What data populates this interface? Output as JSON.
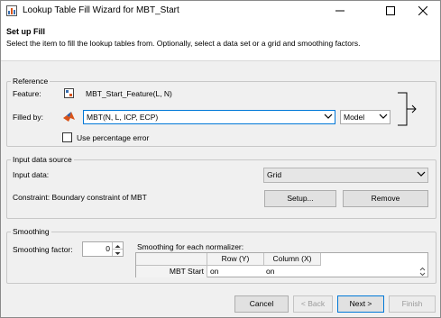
{
  "window": {
    "title": "Lookup Table Fill Wizard for MBT_Start"
  },
  "header": {
    "heading": "Set up Fill",
    "description": "Select the item to fill the lookup tables from. Optionally, select a data set or a grid and smoothing factors."
  },
  "reference": {
    "group_label": "Reference",
    "feature_label": "Feature:",
    "feature_value": "MBT_Start_Feature(L, N)",
    "filled_by_label": "Filled by:",
    "filled_by_value": "MBT(N, L, ICP, ECP)",
    "type_value": "Model",
    "percentage_error_label": "Use percentage error",
    "percentage_error_checked": false
  },
  "input_source": {
    "group_label": "Input data source",
    "input_data_label": "Input data:",
    "input_data_value": "Grid",
    "constraint_text": "Constraint: Boundary constraint of MBT",
    "setup_label": "Setup...",
    "remove_label": "Remove"
  },
  "smoothing": {
    "group_label": "Smoothing",
    "factor_label": "Smoothing factor:",
    "factor_value": "0",
    "per_normalizer_label": "Smoothing for each normalizer:",
    "columns": [
      "Row (Y)",
      "Column (X)"
    ],
    "rows": [
      {
        "name": "MBT Start",
        "values": [
          "on",
          "on"
        ]
      }
    ]
  },
  "footer": {
    "cancel_label": "Cancel",
    "back_label": "< Back",
    "next_label": "Next >",
    "finish_label": "Finish"
  },
  "colors": {
    "accent_border": "#0078d7",
    "matlab_icon": "#d95319"
  }
}
